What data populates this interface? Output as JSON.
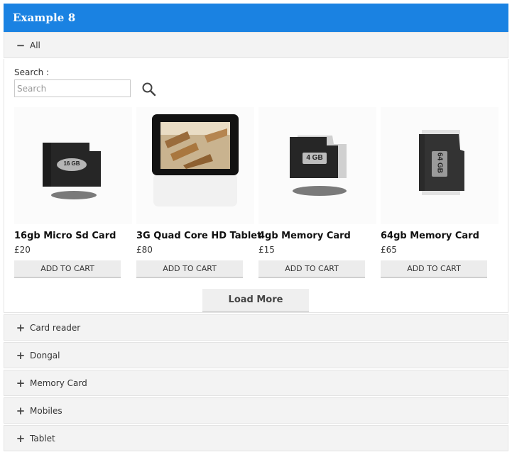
{
  "header": {
    "title": "Example 8"
  },
  "accordion_open": {
    "sign": "−",
    "label": "All"
  },
  "search": {
    "label": "Search :",
    "placeholder": "Search"
  },
  "products": [
    {
      "name": "16gb Micro Sd Card",
      "price": "£20",
      "cart_label": "ADD TO CART",
      "card_text": "16 GB"
    },
    {
      "name": "3G Quad Core HD Tablet",
      "price": "£80",
      "cart_label": "ADD TO CART"
    },
    {
      "name": "4gb Memory Card",
      "price": "£15",
      "cart_label": "ADD TO CART",
      "card_text": "4 GB"
    },
    {
      "name": "64gb Memory Card",
      "price": "£65",
      "cart_label": "ADD TO CART",
      "card_text": "64 GB"
    }
  ],
  "load_more": "Load More",
  "accordion_closed": [
    {
      "sign": "+",
      "label": "Card reader"
    },
    {
      "sign": "+",
      "label": "Dongal"
    },
    {
      "sign": "+",
      "label": "Memory Card"
    },
    {
      "sign": "+",
      "label": "Mobiles"
    },
    {
      "sign": "+",
      "label": "Tablet"
    }
  ],
  "colors": {
    "header": "#1a82e2",
    "accordion_bg": "#f3f3f3",
    "button_bg": "#ececec"
  }
}
